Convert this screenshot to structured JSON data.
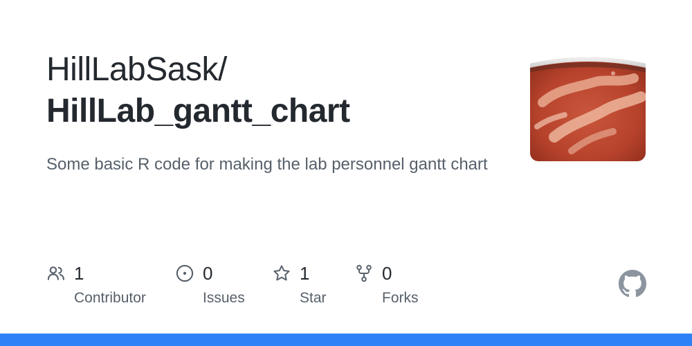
{
  "repo": {
    "owner": "HillLabSask/",
    "name": "HillLab_gantt_chart",
    "description": "Some basic R code for making the lab personnel gantt chart"
  },
  "stats": {
    "contributors": {
      "count": "1",
      "label": "Contributor",
      "icon": "people-icon"
    },
    "issues": {
      "count": "0",
      "label": "Issues",
      "icon": "issue-opened-icon"
    },
    "stars": {
      "count": "1",
      "label": "Star",
      "icon": "star-icon"
    },
    "forks": {
      "count": "0",
      "label": "Forks",
      "icon": "repo-forked-icon"
    }
  },
  "icons": {
    "brand": "github-mark-icon",
    "avatar": "owner-avatar"
  },
  "colors": {
    "text_primary": "#24292f",
    "text_secondary": "#57606a",
    "icon": "#57606a",
    "accent_bar": "#2f81f7"
  }
}
